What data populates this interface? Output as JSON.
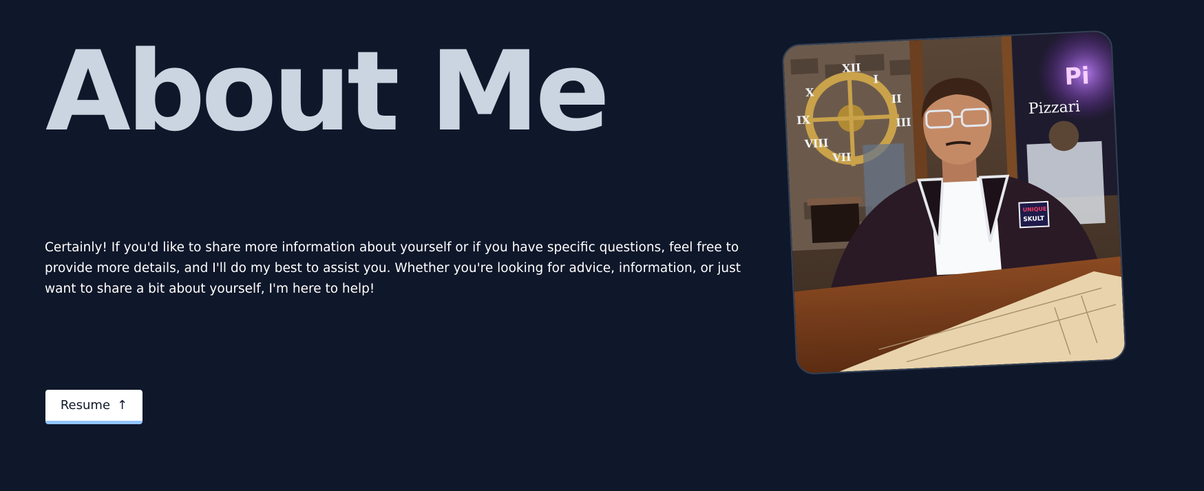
{
  "hero": {
    "title": "About Me",
    "description": "Certainly! If you'd like to share more information about yourself or if you have specific questions, feel free to provide more details, and I'll do my best to assist you. Whether you're looking for advice, information, or just want to share a bit about yourself, I'm here to help!"
  },
  "resume_button": {
    "label": "Resume",
    "icon": "arrow-up-icon",
    "arrow_glyph": "↑"
  },
  "profile_photo": {
    "badge_lines": [
      "UNIQUE",
      "SKULT"
    ],
    "sign_text": "Pizzari"
  },
  "colors": {
    "background": "#0f172a",
    "heading": "#cbd5e1",
    "body_text": "#ffffff",
    "button_bg": "#ffffff",
    "button_accent": "#93c5fd"
  }
}
